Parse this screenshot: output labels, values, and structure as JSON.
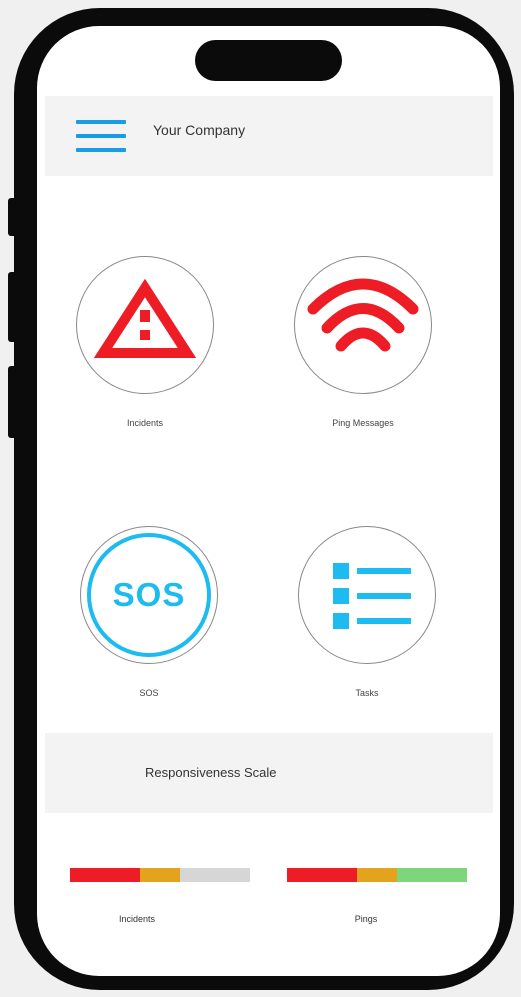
{
  "header": {
    "company": "Your Company",
    "menu_icon": "hamburger-menu-icon"
  },
  "tiles": [
    {
      "label": "Incidents",
      "icon": "warning-triangle-icon",
      "color": "#ee1c25"
    },
    {
      "label": "Ping Messages",
      "icon": "wifi-signal-icon",
      "color": "#ee1c25"
    },
    {
      "label": "SOS",
      "icon": "sos-icon",
      "icon_text": "SOS",
      "color": "#1dbbf0"
    },
    {
      "label": "Tasks",
      "icon": "task-list-icon",
      "color": "#1dbbf0"
    }
  ],
  "scale": {
    "title": "Responsiveness Scale",
    "bars": [
      {
        "label": "Incidents",
        "segments": [
          {
            "color": "#ee1c25",
            "fraction": 0.39
          },
          {
            "color": "#e3a31c",
            "fraction": 0.22
          },
          {
            "color": "#d6d6d6",
            "fraction": 0.39
          }
        ]
      },
      {
        "label": "Pings",
        "segments": [
          {
            "color": "#ee1c25",
            "fraction": 0.39
          },
          {
            "color": "#e3a31c",
            "fraction": 0.22
          },
          {
            "color": "#7ed67a",
            "fraction": 0.39
          }
        ]
      }
    ]
  }
}
